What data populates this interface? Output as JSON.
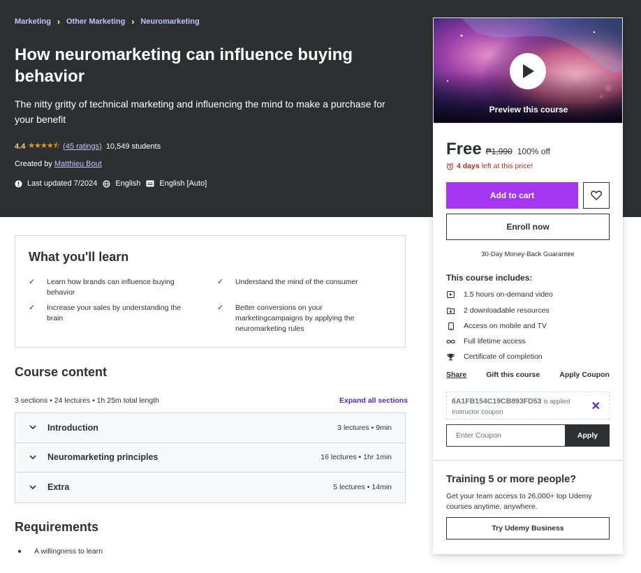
{
  "breadcrumb": [
    "Marketing",
    "Other Marketing",
    "Neuromarketing"
  ],
  "course": {
    "title": "How neuromarketing can influence buying behavior",
    "subtitle": "The nitty gritty of technical marketing and influencing the mind to make a purchase for your benefit",
    "rating": "4.4",
    "rating_stars": 4.4,
    "ratings_count": "(45 ratings)",
    "students": "10,549 students",
    "created_by_label": "Created by",
    "instructor": "Matthieu Bout",
    "last_updated": "Last updated 7/2024",
    "language": "English",
    "captions": "English [Auto]"
  },
  "learn": {
    "title": "What you'll learn",
    "items": [
      "Learn how brands can influence buying behavior",
      "Understand the mind of the consumer",
      "Increase your sales by understanding the brain",
      "Better conversions on your marketingcampaigns by applying the neuromarketing rules"
    ]
  },
  "content": {
    "title": "Course content",
    "meta": "3 sections • 24 lectures • 1h 25m total length",
    "expand": "Expand all sections",
    "sections": [
      {
        "name": "Introduction",
        "info": "3 lectures • 9min"
      },
      {
        "name": "Neuromarketing principles",
        "info": "16 lectures • 1hr 1min"
      },
      {
        "name": "Extra",
        "info": "5 lectures • 14min"
      }
    ]
  },
  "requirements": {
    "title": "Requirements",
    "items": [
      "A willingness to learn"
    ]
  },
  "sidebar": {
    "preview_label": "Preview this course",
    "price": "Free",
    "original_price": "₱1,990",
    "discount": "100% off",
    "timer_days": "4 days",
    "timer_text": "left at this price!",
    "add_to_cart": "Add to cart",
    "enroll": "Enroll now",
    "guarantee": "30-Day Money-Back Guarantee",
    "includes_title": "This course includes:",
    "includes": [
      {
        "icon": "video-icon",
        "text": "1.5 hours on-demand video"
      },
      {
        "icon": "download-icon",
        "text": "2 downloadable resources"
      },
      {
        "icon": "mobile-icon",
        "text": "Access on mobile and TV"
      },
      {
        "icon": "infinity-icon",
        "text": "Full lifetime access"
      },
      {
        "icon": "trophy-icon",
        "text": "Certificate of completion"
      }
    ],
    "share": "Share",
    "gift": "Gift this course",
    "apply_coupon": "Apply Coupon",
    "coupon_code": "6A1FB154C19CB893FD53",
    "coupon_applied": "is applied",
    "coupon_type": "Instructor coupon",
    "coupon_placeholder": "Enter Coupon",
    "apply": "Apply",
    "business_title": "Training 5 or more people?",
    "business_text": "Get your team access to 26,000+ top Udemy courses anytime, anywhere.",
    "business_button": "Try Udemy Business"
  },
  "colors": {
    "hero_bg": "#2d2f31",
    "accent_purple": "#a435f0",
    "link_purple": "#5624d0",
    "star": "#e59819",
    "timer_red": "#b32d0f"
  }
}
